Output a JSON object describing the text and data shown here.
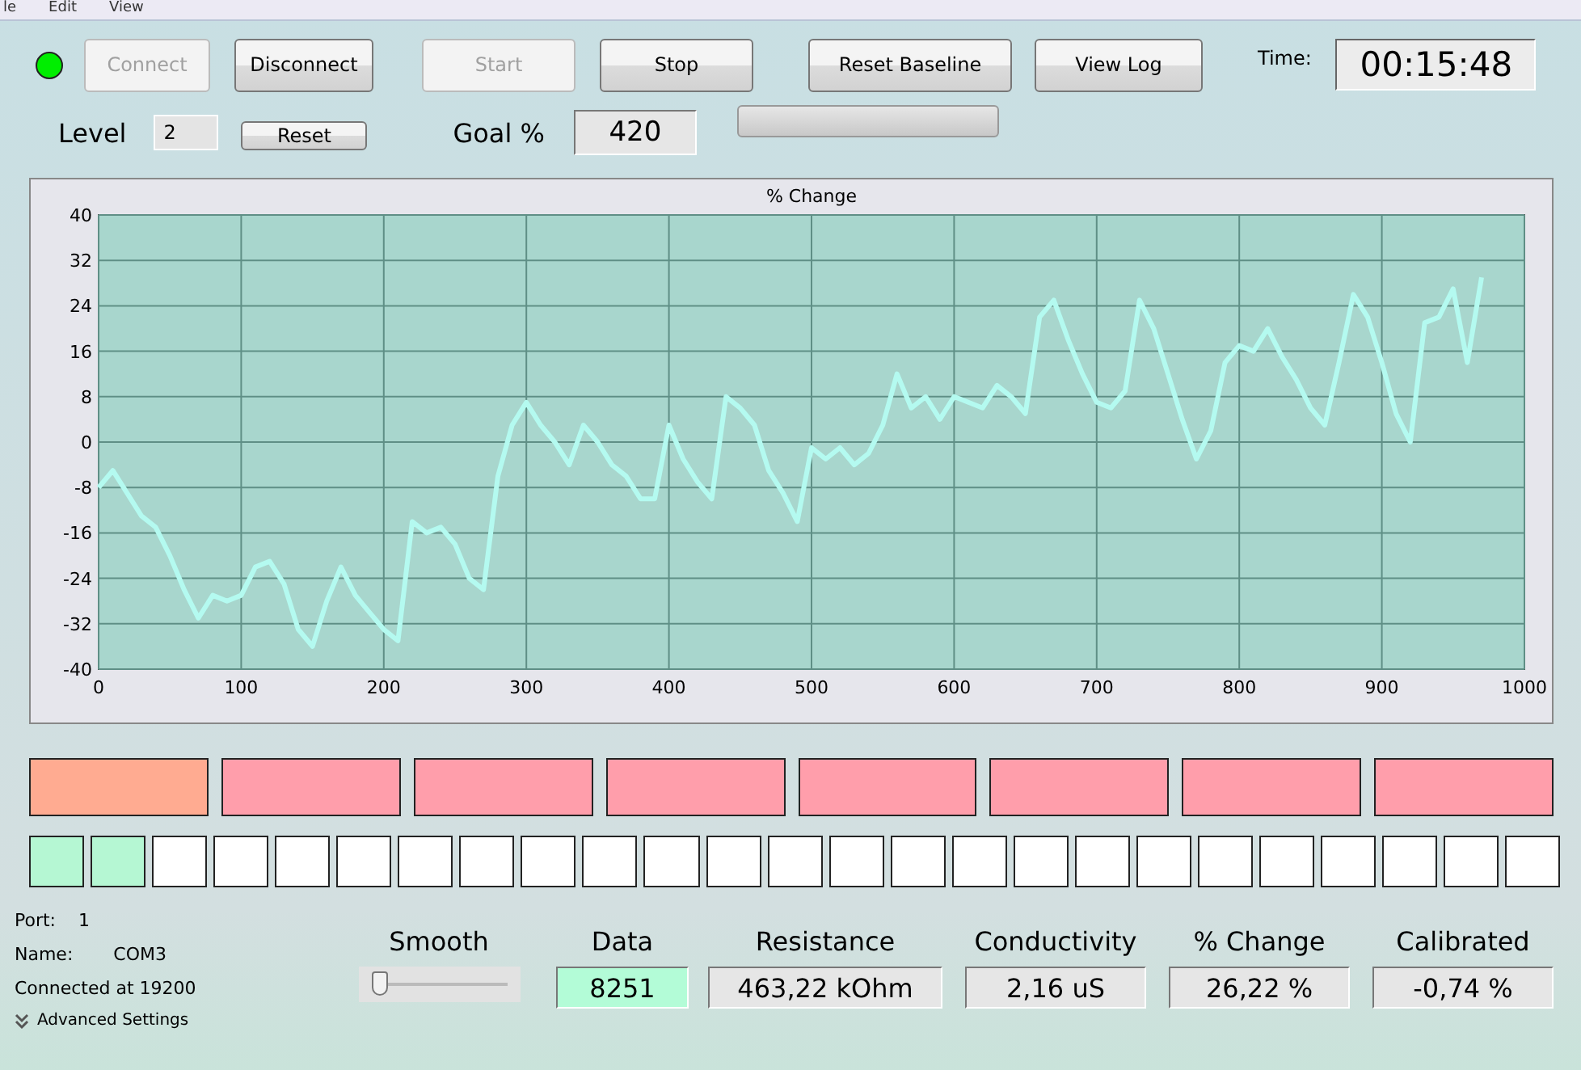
{
  "menu": [
    "le",
    "Edit",
    "View"
  ],
  "status_led": {
    "on": true
  },
  "toolbar": [
    {
      "label": "Connect",
      "disabled": true
    },
    {
      "label": "Disconnect",
      "disabled": false
    },
    {
      "label": "Start",
      "disabled": true
    },
    {
      "label": "Stop",
      "disabled": false
    },
    {
      "label": "Reset Baseline",
      "disabled": false
    },
    {
      "label": "View Log",
      "disabled": false
    }
  ],
  "time": {
    "label": "Time:",
    "value": "00:15:48"
  },
  "level": {
    "label": "Level",
    "value": "2",
    "reset_button": "Reset"
  },
  "goal": {
    "label": "Goal %",
    "value": "420"
  },
  "progress": {
    "level": 0
  },
  "chart": {
    "chart_data": {
      "type": "line",
      "title": "% Change",
      "grid": true,
      "xlim": [
        0,
        1000
      ],
      "ylim": [
        -40,
        40
      ],
      "xticks": [
        0,
        100,
        200,
        300,
        400,
        500,
        600,
        700,
        800,
        900,
        1000
      ],
      "yticks": [
        -40,
        -32,
        -24,
        -16,
        -8,
        0,
        8,
        16,
        24,
        32,
        40
      ],
      "x": [
        0,
        10,
        20,
        30,
        40,
        50,
        60,
        70,
        80,
        90,
        100,
        110,
        120,
        130,
        140,
        150,
        160,
        170,
        180,
        190,
        200,
        210,
        220,
        230,
        240,
        250,
        260,
        270,
        280,
        290,
        300,
        310,
        320,
        330,
        340,
        350,
        360,
        370,
        380,
        390,
        400,
        410,
        420,
        430,
        440,
        450,
        460,
        470,
        480,
        490,
        500,
        510,
        520,
        530,
        540,
        550,
        560,
        570,
        580,
        590,
        600,
        610,
        620,
        630,
        640,
        650,
        660,
        670,
        680,
        690,
        700,
        710,
        720,
        730,
        740,
        750,
        760,
        770,
        780,
        790,
        800,
        810,
        820,
        830,
        840,
        850,
        860,
        870,
        880,
        890,
        900,
        910,
        920,
        930,
        940,
        950,
        960,
        970
      ],
      "series": [
        {
          "color": "#b4faf0",
          "values": [
            -8,
            -5,
            -9,
            -13,
            -15,
            -20,
            -26,
            -31,
            -27,
            -28,
            -27,
            -22,
            -21,
            -25,
            -33,
            -36,
            -28,
            -22,
            -27,
            -30,
            -33,
            -35,
            -14,
            -16,
            -15,
            -18,
            -24,
            -26,
            -6,
            3,
            7,
            3,
            0,
            -4,
            3,
            0,
            -4,
            -6,
            -10,
            -10,
            3,
            -3,
            -7,
            -10,
            8,
            6,
            3,
            -5,
            -9,
            -14,
            -1,
            -3,
            -1,
            -4,
            -2,
            3,
            12,
            6,
            8,
            4,
            8,
            7,
            6,
            10,
            8,
            5,
            22,
            25,
            18,
            12,
            7,
            6,
            9,
            25,
            20,
            12,
            4,
            -3,
            2,
            14,
            17,
            16,
            20,
            15,
            11,
            6,
            3,
            14,
            26,
            22,
            14,
            5,
            0,
            21,
            22,
            27,
            14,
            29
          ]
        }
      ]
    }
  },
  "zones": [
    {
      "color": "#ffab91"
    },
    {
      "color": "#ff9eab"
    },
    {
      "color": "#ff9eab"
    },
    {
      "color": "#ff9eab"
    },
    {
      "color": "#ff9eab"
    },
    {
      "color": "#ff9eab"
    },
    {
      "color": "#ff9eab"
    },
    {
      "color": "#ff9eab"
    }
  ],
  "cells": [
    {
      "color": "#b5f7d3"
    },
    {
      "color": "#b5f7d3"
    },
    {
      "color": "#ffffff"
    },
    {
      "color": "#ffffff"
    },
    {
      "color": "#ffffff"
    },
    {
      "color": "#ffffff"
    },
    {
      "color": "#ffffff"
    },
    {
      "color": "#ffffff"
    },
    {
      "color": "#ffffff"
    },
    {
      "color": "#ffffff"
    },
    {
      "color": "#ffffff"
    },
    {
      "color": "#ffffff"
    },
    {
      "color": "#ffffff"
    },
    {
      "color": "#ffffff"
    },
    {
      "color": "#ffffff"
    },
    {
      "color": "#ffffff"
    },
    {
      "color": "#ffffff"
    },
    {
      "color": "#ffffff"
    },
    {
      "color": "#ffffff"
    },
    {
      "color": "#ffffff"
    },
    {
      "color": "#ffffff"
    },
    {
      "color": "#ffffff"
    },
    {
      "color": "#ffffff"
    },
    {
      "color": "#ffffff"
    },
    {
      "color": "#ffffff"
    }
  ],
  "connection": {
    "port_label": "Port:",
    "port": "1",
    "name_label": "Name:",
    "name": "COM3",
    "status": "Connected at 19200",
    "advanced": "Advanced Settings"
  },
  "smooth": {
    "label": "Smooth",
    "level": 0.05
  },
  "readouts": [
    {
      "label": "Data",
      "value": "8251",
      "color": "#b3fcd7"
    },
    {
      "label": "Resistance",
      "value": "463,22 kOhm",
      "color": "#e6e6e6"
    },
    {
      "label": "Conductivity",
      "value": "2,16 uS",
      "color": "#e6e6e6"
    },
    {
      "label": "% Change",
      "value": "26,22 %",
      "color": "#e6e6e6"
    },
    {
      "label": "Calibrated",
      "value": "-0,74 %",
      "color": "#e6e6e6"
    }
  ]
}
